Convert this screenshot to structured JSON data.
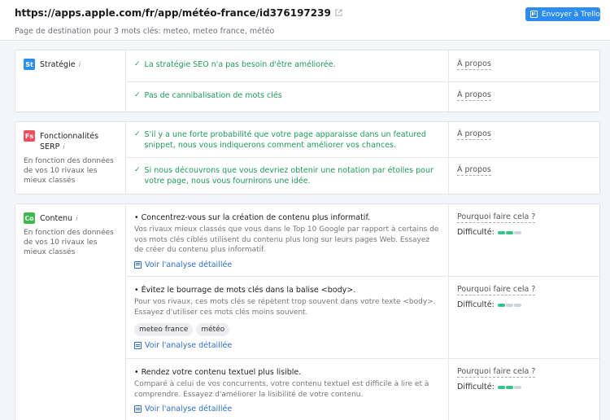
{
  "header": {
    "url": "https://apps.apple.com/fr/app/météo-france/id376197239",
    "subtitle": "Page de destination pour 3 mots clés: meteo, meteo france, météo",
    "trello_label": "Envoyer à Trello"
  },
  "colors": {
    "accent": "#2d8cf0",
    "success": "#1f9a57",
    "difficulty": "#35c28c"
  },
  "strategy": {
    "badge": "St",
    "name": "Stratégie",
    "info": "i",
    "rows": [
      {
        "text": "La stratégie SEO n'a pas besoin d'être améliorée.",
        "link": "À propos"
      },
      {
        "text": "Pas de cannibalisation de mots clés",
        "link": "À propos"
      }
    ]
  },
  "serp": {
    "badge": "Fs",
    "name": "Fonctionnalités SERP",
    "info": "i",
    "desc": "En fonction des données de vos 10 rivaux les mieux classés",
    "rows": [
      {
        "text": "S'il y a une forte probabilité que votre page apparaisse dans un featured snippet, nous vous indiquerons comment améliorer vos chances.",
        "link": "À propos"
      },
      {
        "text": "Si nous découvrons que vous devriez obtenir une notation par étoiles pour votre page, nous vous fournirons une idée.",
        "link": "À propos"
      }
    ]
  },
  "content": {
    "badge": "Co",
    "name": "Contenu",
    "info": "i",
    "desc": "En fonction des données de vos 10 rivaux les mieux classés",
    "why_label": "Pourquoi faire cela ?",
    "difficulty_label": "Difficulté:",
    "detail_label": "Voir l'analyse détaillée",
    "tips": [
      {
        "title": "• Concentrez-vous sur la création de contenu plus informatif.",
        "text": "Vos rivaux mieux classés que vous dans le Top 10 Google par rapport à certains de vos mots clés ciblés utilisent du contenu plus long sur leurs pages Web. Essayez de créer du contenu plus informatif.",
        "difficulty": 2
      },
      {
        "title": "• Évitez le bourrage de mots clés dans la balise <body>.",
        "text": "Pour vos rivaux, ces mots clés se répètent trop souvent dans votre texte <body>. Essayez d'utiliser ces mots clés moins souvent.",
        "tags": [
          "meteo france",
          "météo"
        ],
        "difficulty": 1
      },
      {
        "title": "• Rendez votre contenu textuel plus lisible.",
        "text": "Comparé à celui de vos concurrents, votre contenu textuel est difficile à lire et à comprendre. Essayez d'améliorer la lisibilité de votre contenu.",
        "difficulty": 2
      }
    ]
  }
}
